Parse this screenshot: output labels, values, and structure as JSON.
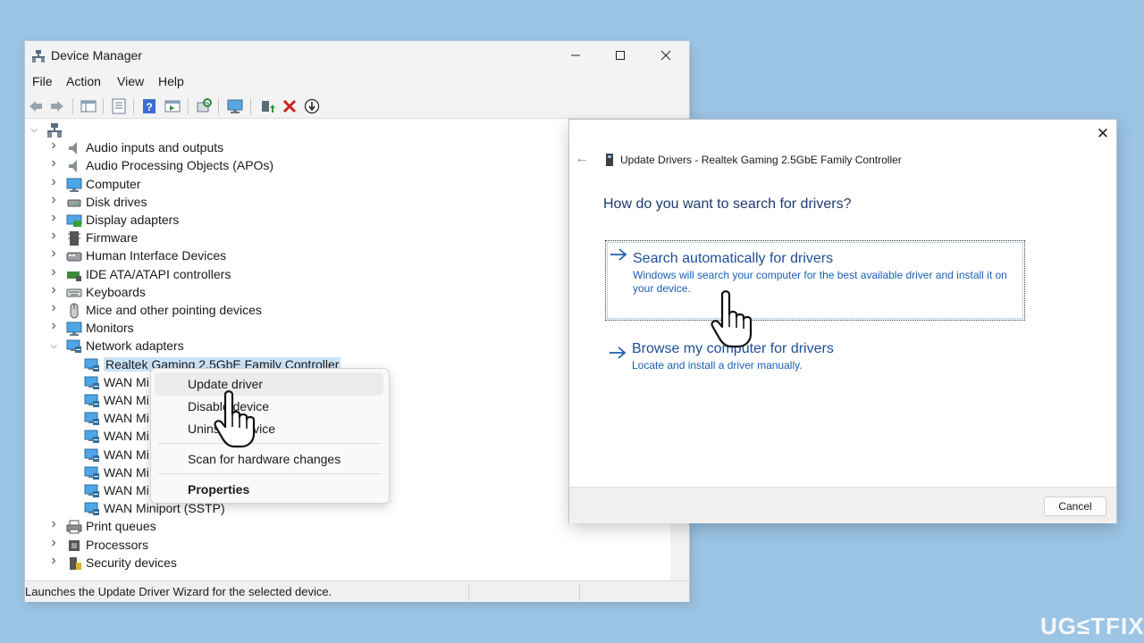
{
  "device_manager": {
    "title": "Device Manager",
    "menu": [
      "File",
      "Action",
      "View",
      "Help"
    ],
    "toolbar_icons": [
      "back-arrow-icon",
      "forward-arrow-icon",
      "show-hide-tree-icon",
      "properties-icon",
      "help-icon",
      "view-icon",
      "scan-hardware-icon",
      "monitor-icon",
      "update-driver-icon",
      "uninstall-icon",
      "disable-icon"
    ],
    "tree": [
      {
        "label": "",
        "icon": "computer-tree-root-icon",
        "expanded": true,
        "level": 0
      },
      {
        "label": "Audio inputs and outputs",
        "icon": "speaker-icon",
        "level": 1
      },
      {
        "label": "Audio Processing Objects (APOs)",
        "icon": "speaker-icon",
        "level": 1
      },
      {
        "label": "Computer",
        "icon": "monitor-icon",
        "level": 1
      },
      {
        "label": "Disk drives",
        "icon": "disk-drive-icon",
        "level": 1
      },
      {
        "label": "Display adapters",
        "icon": "display-adapter-icon",
        "level": 1
      },
      {
        "label": "Firmware",
        "icon": "firmware-icon",
        "level": 1
      },
      {
        "label": "Human Interface Devices",
        "icon": "hid-icon",
        "level": 1
      },
      {
        "label": "IDE ATA/ATAPI controllers",
        "icon": "ide-controller-icon",
        "level": 1
      },
      {
        "label": "Keyboards",
        "icon": "keyboard-icon",
        "level": 1
      },
      {
        "label": "Mice and other pointing devices",
        "icon": "mouse-icon",
        "level": 1
      },
      {
        "label": "Monitors",
        "icon": "monitor-icon",
        "level": 1
      },
      {
        "label": "Network adapters",
        "icon": "network-icon",
        "expanded": true,
        "level": 1
      },
      {
        "label": "Realtek Gaming 2.5GbE Family Controller",
        "icon": "network-icon",
        "level": 2,
        "selected": true
      },
      {
        "label": "WAN Mi",
        "icon": "network-icon",
        "level": 2
      },
      {
        "label": "WAN Mi",
        "icon": "network-icon",
        "level": 2
      },
      {
        "label": "WAN Mi",
        "icon": "network-icon",
        "level": 2
      },
      {
        "label": "WAN Mi",
        "icon": "network-icon",
        "level": 2
      },
      {
        "label": "WAN Mi",
        "icon": "network-icon",
        "level": 2
      },
      {
        "label": "WAN Mi",
        "icon": "network-icon",
        "level": 2
      },
      {
        "label": "WAN Mi",
        "icon": "network-icon",
        "level": 2
      },
      {
        "label": "WAN Miniport (SSTP)",
        "icon": "network-icon",
        "level": 2
      },
      {
        "label": "Print queues",
        "icon": "printer-icon",
        "level": 1
      },
      {
        "label": "Processors",
        "icon": "processor-icon",
        "level": 1
      },
      {
        "label": "Security devices",
        "icon": "security-device-icon",
        "level": 1
      }
    ],
    "status": "Launches the Update Driver Wizard for the selected device."
  },
  "context_menu": {
    "items": [
      {
        "label": "Update driver",
        "highlighted": true
      },
      {
        "label": "Disable device"
      },
      {
        "label": "Uninstall device"
      },
      {
        "label": "Scan for hardware changes"
      },
      {
        "label": "Properties",
        "bold": true
      }
    ]
  },
  "update_dialog": {
    "header": "Update Drivers - Realtek Gaming 2.5GbE Family Controller",
    "question": "How do you want to search for drivers?",
    "options": [
      {
        "title": "Search automatically for drivers",
        "description": "Windows will search your computer for the best available driver and install it on your device."
      },
      {
        "title": "Browse my computer for drivers",
        "description": "Locate and install a driver manually."
      }
    ],
    "cancel_label": "Cancel",
    "close_glyph": "✕",
    "back_glyph": "←"
  },
  "watermark": "UG≤TFIX",
  "colors": {
    "background": "#9cc4e4",
    "link_blue": "#1f4e99",
    "accent_blue": "#1a5fb4"
  }
}
